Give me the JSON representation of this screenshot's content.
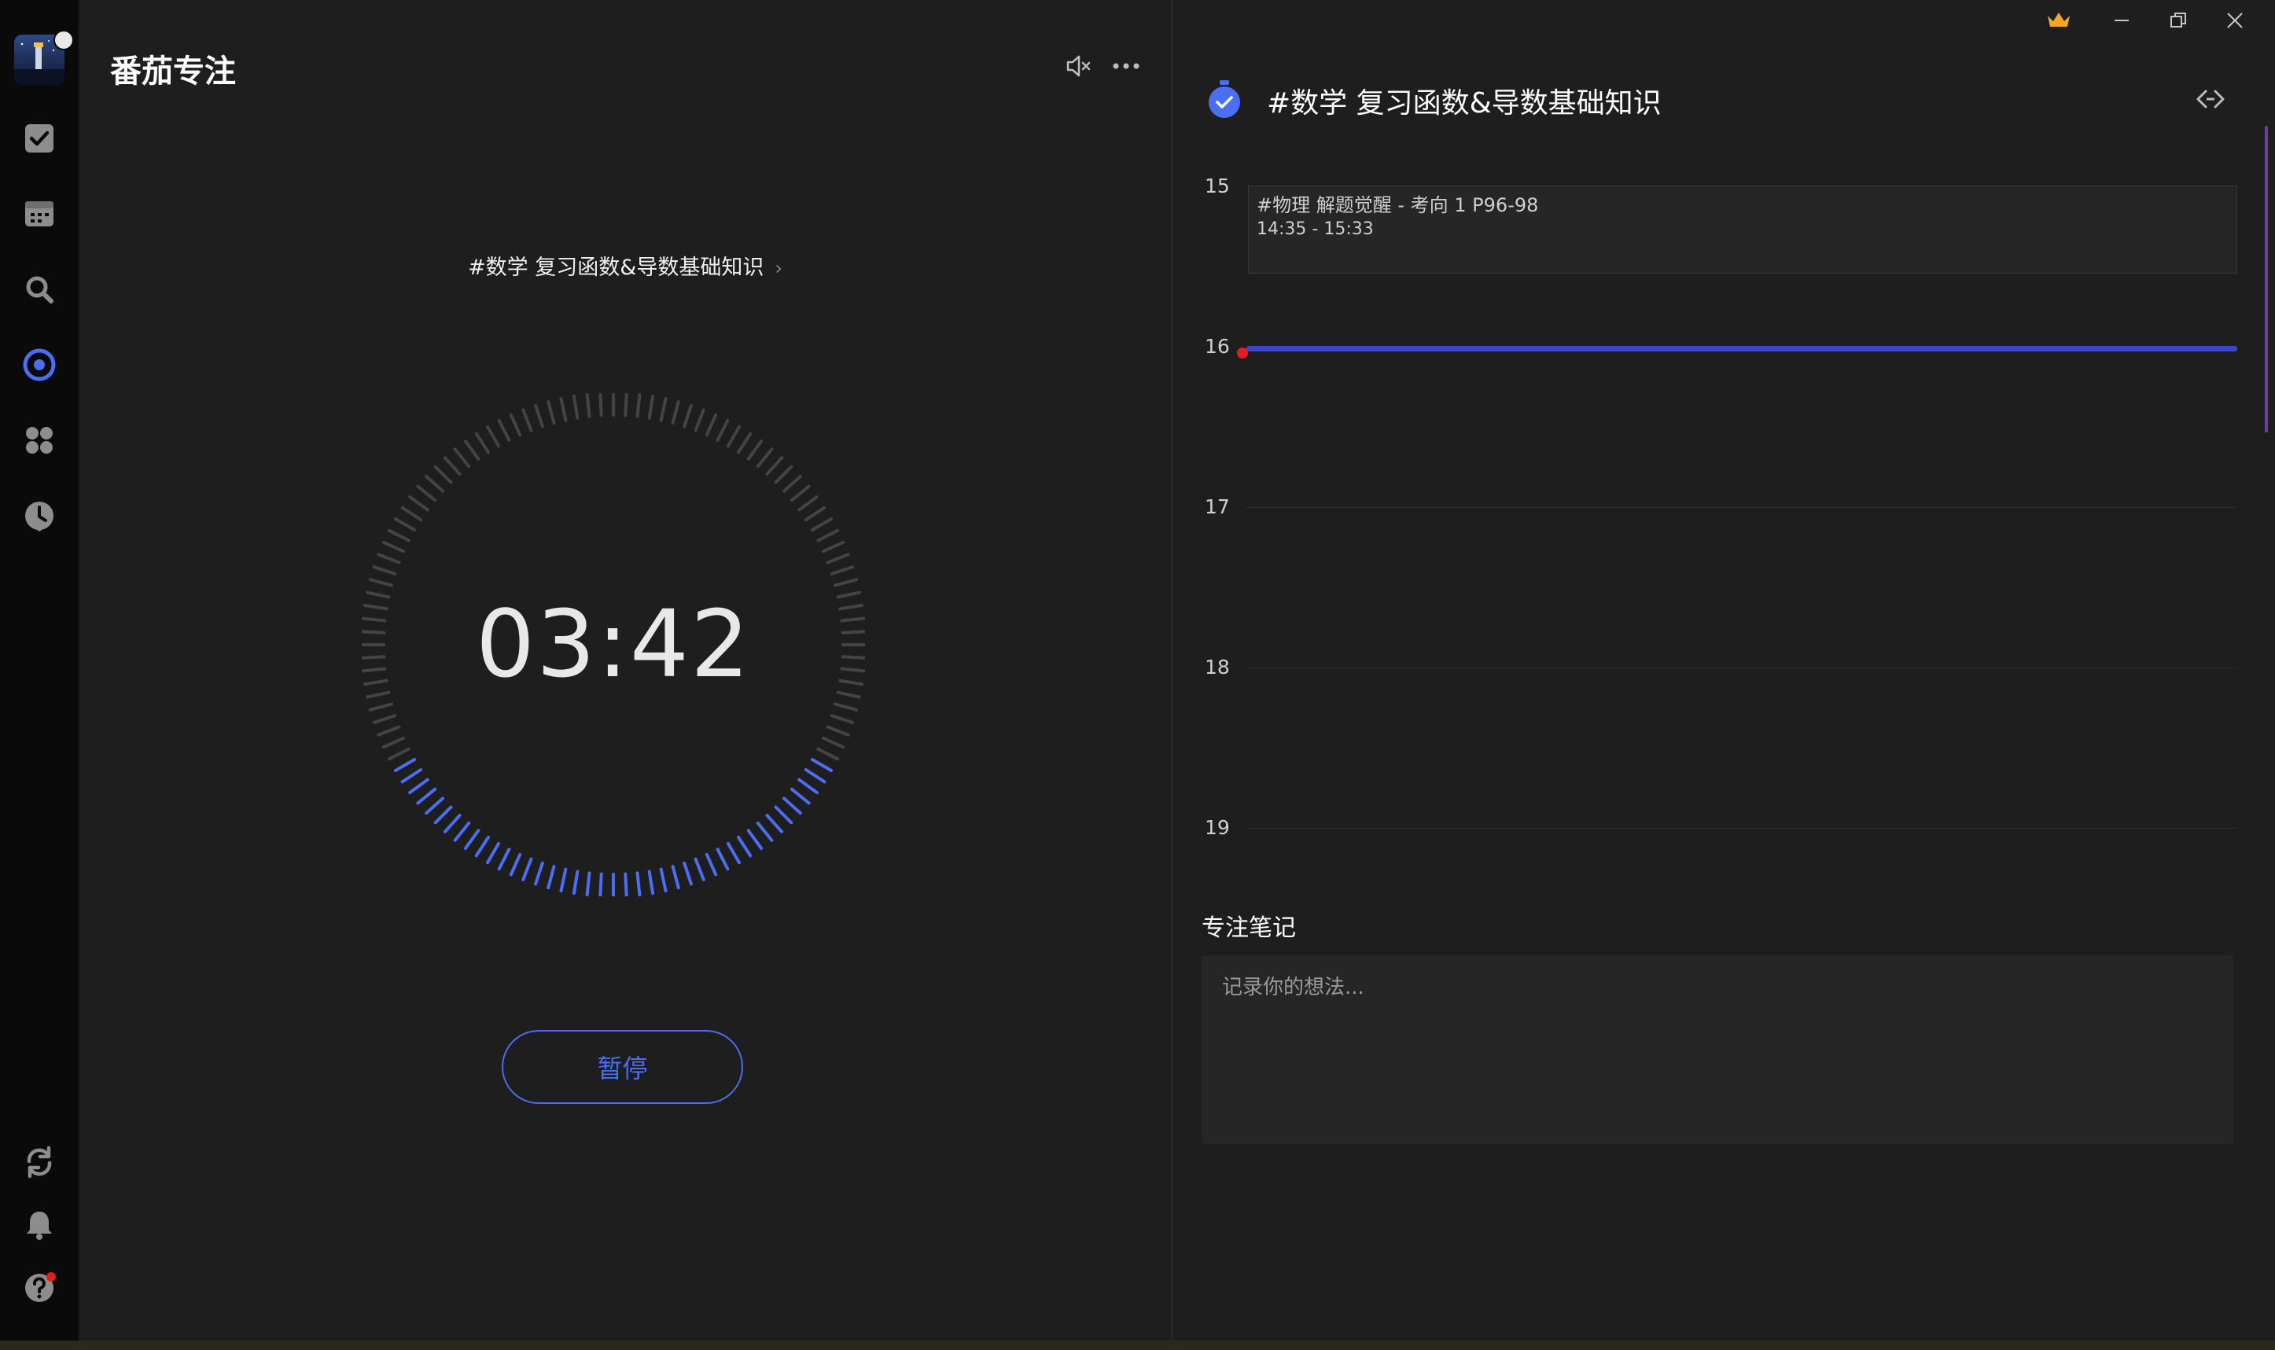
{
  "app": {
    "section_title": "番茄专注"
  },
  "sidebar": {
    "items": [
      {
        "icon": "checkbox-icon"
      },
      {
        "icon": "calendar-icon"
      },
      {
        "icon": "search-icon"
      },
      {
        "icon": "pomodoro-icon",
        "active": true
      },
      {
        "icon": "apps-icon"
      },
      {
        "icon": "clock-icon"
      }
    ],
    "bottom": [
      {
        "icon": "sync-icon"
      },
      {
        "icon": "bell-icon"
      },
      {
        "icon": "help-icon"
      }
    ]
  },
  "focus": {
    "task_name": "#数学 复习函数&导数基础知识",
    "timer": "03:42",
    "progress": 0.35,
    "pause_label": "暂停"
  },
  "detail": {
    "task_title": "#数学 复习函数&导数基础知识",
    "hours": [
      "15",
      "16",
      "17",
      "18",
      "19"
    ],
    "event": {
      "title": "#物理 解题觉醒 - 考向 1 P96-98",
      "time": "14:35 - 15:33"
    },
    "notes_label": "专注笔记",
    "notes_placeholder": "记录你的想法..."
  },
  "colors": {
    "accent": "#4a6ef5",
    "background": "#1e1e1e",
    "sidebar": "#0a0a0a",
    "now_line": "#3b46c8",
    "now_dot": "#e01f1f",
    "crown": "#f5a623"
  }
}
